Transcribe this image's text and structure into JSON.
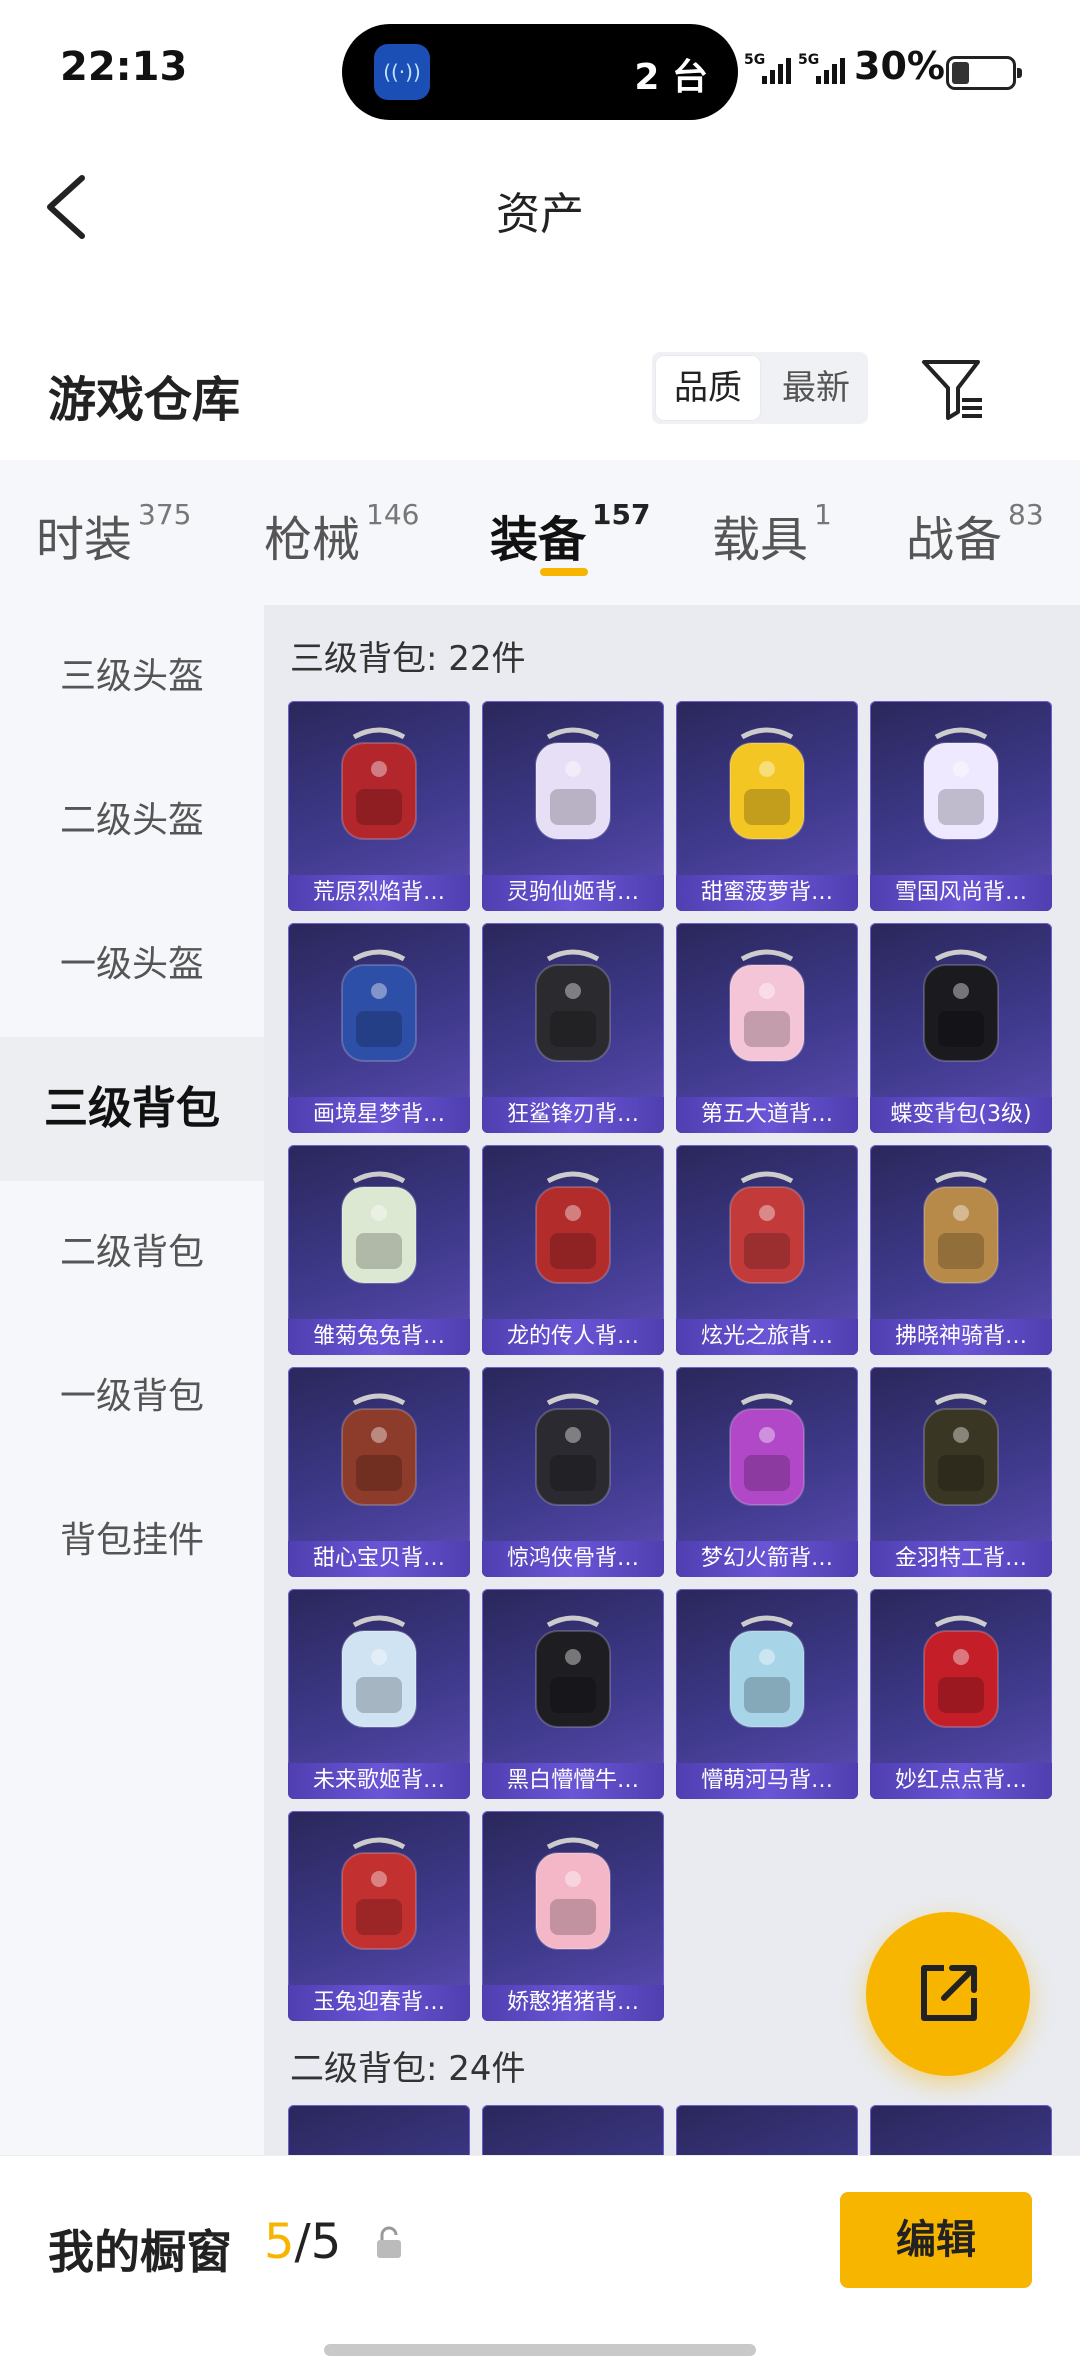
{
  "status_bar": {
    "time": "22:13",
    "island_count": "2 台",
    "sig1": "5G",
    "sig2": "5G",
    "battery": "30%",
    "battery_level": 0.3
  },
  "nav": {
    "title": "资产"
  },
  "warehouse": {
    "heading": "游戏仓库",
    "sort_options": [
      "品质",
      "最新"
    ],
    "sort_selected": "品质"
  },
  "tabs": [
    {
      "label": "时装",
      "count": "375"
    },
    {
      "label": "枪械",
      "count": "146"
    },
    {
      "label": "装备",
      "count": "157",
      "active": true
    },
    {
      "label": "载具",
      "count": "1"
    },
    {
      "label": "战备",
      "count": "83"
    }
  ],
  "sidebar": [
    "三级头盔",
    "二级头盔",
    "一级头盔",
    "三级背包",
    "二级背包",
    "一级背包",
    "背包挂件"
  ],
  "sidebar_active": "三级背包",
  "sections": [
    {
      "title": "三级背包: 22件",
      "items": [
        {
          "name": "荒原烈焰背…",
          "color": "#b3262c"
        },
        {
          "name": "灵驹仙姬背…",
          "color": "#e6dff5"
        },
        {
          "name": "甜蜜菠萝背…",
          "color": "#f3c623"
        },
        {
          "name": "雪国风尚背…",
          "color": "#efe9ff"
        },
        {
          "name": "画境星梦背…",
          "color": "#2d4fa8"
        },
        {
          "name": "狂鲨锋刃背…",
          "color": "#2b2a2e"
        },
        {
          "name": "第五大道背…",
          "color": "#f4c5d6"
        },
        {
          "name": "蝶变背包(3级)",
          "color": "#1a1a1f"
        },
        {
          "name": "雏菊兔兔背…",
          "color": "#dde8d3"
        },
        {
          "name": "龙的传人背…",
          "color": "#b32c2c"
        },
        {
          "name": "炫光之旅背…",
          "color": "#c23a3a"
        },
        {
          "name": "拂晓神骑背…",
          "color": "#b78a4a"
        },
        {
          "name": "甜心宝贝背…",
          "color": "#8d3b2a"
        },
        {
          "name": "惊鸿侠骨背…",
          "color": "#2a2a30"
        },
        {
          "name": "梦幻火箭背…",
          "color": "#b048c8"
        },
        {
          "name": "金羽特工背…",
          "color": "#3a3624"
        },
        {
          "name": "未来歌姬背…",
          "color": "#cfe3f2"
        },
        {
          "name": "黑白懵懵牛…",
          "color": "#1d1d22"
        },
        {
          "name": "懵萌河马背…",
          "color": "#a8d4e8"
        },
        {
          "name": "妙红点点背…",
          "color": "#c41f28"
        },
        {
          "name": "玉兔迎春背…",
          "color": "#c2302f"
        },
        {
          "name": "娇憨猪猪背…",
          "color": "#f3b7c8"
        }
      ]
    },
    {
      "title": "二级背包: 24件",
      "items": []
    }
  ],
  "bottom": {
    "label": "我的橱窗",
    "used": "5",
    "sep": "/",
    "total": "5",
    "edit": "编辑"
  }
}
